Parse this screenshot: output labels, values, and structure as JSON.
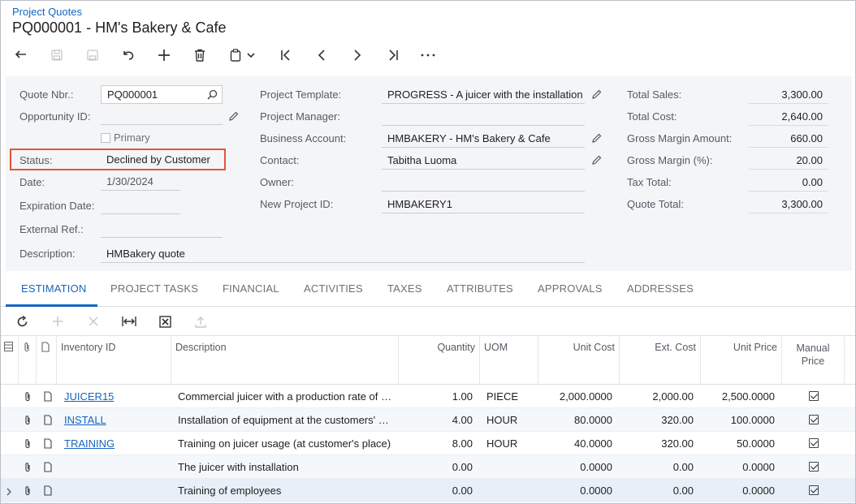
{
  "breadcrumb": "Project Quotes",
  "title": "PQ000001 - HM's Bakery & Cafe",
  "toolbar": {
    "icons": [
      "back-icon",
      "save-close-icon",
      "save-icon",
      "undo-icon",
      "add-icon",
      "delete-icon",
      "copy-paste-icon",
      "chevron-down-icon",
      "first-record-icon",
      "previous-record-icon",
      "next-record-icon",
      "last-record-icon",
      "more-icon"
    ]
  },
  "form": {
    "quote_nbr_label": "Quote Nbr.:",
    "quote_nbr": "PQ000001",
    "opportunity_label": "Opportunity ID:",
    "opportunity": "",
    "primary_label": "Primary",
    "status_label": "Status:",
    "status": "Declined by Customer",
    "date_label": "Date:",
    "date": "1/30/2024",
    "expiration_label": "Expiration Date:",
    "expiration": "",
    "external_ref_label": "External Ref.:",
    "external_ref": "",
    "description_label": "Description:",
    "description": "HMBakery quote",
    "project_template_label": "Project Template:",
    "project_template": "PROGRESS - A juicer with the installation",
    "project_manager_label": "Project Manager:",
    "project_manager": "",
    "business_account_label": "Business Account:",
    "business_account": "HMBAKERY - HM's Bakery & Cafe",
    "contact_label": "Contact:",
    "contact": "Tabitha Luoma",
    "owner_label": "Owner:",
    "owner": "",
    "new_project_label": "New Project ID:",
    "new_project": "HMBAKERY1",
    "total_sales_label": "Total Sales:",
    "total_sales": "3,300.00",
    "total_cost_label": "Total Cost:",
    "total_cost": "2,640.00",
    "gross_margin_amount_label": "Gross Margin Amount:",
    "gross_margin_amount": "660.00",
    "gross_margin_pct_label": "Gross Margin (%):",
    "gross_margin_pct": "20.00",
    "tax_total_label": "Tax Total:",
    "tax_total": "0.00",
    "quote_total_label": "Quote Total:",
    "quote_total": "3,300.00"
  },
  "tabs": [
    "ESTIMATION",
    "PROJECT TASKS",
    "FINANCIAL",
    "ACTIVITIES",
    "TAXES",
    "ATTRIBUTES",
    "APPROVALS",
    "ADDRESSES"
  ],
  "active_tab": "ESTIMATION",
  "grid_toolbar": [
    "refresh-icon",
    "add-row-icon",
    "delete-row-icon",
    "fit-columns-icon",
    "export-excel-icon",
    "upload-icon"
  ],
  "grid": {
    "columns": {
      "inventory_id": "Inventory ID",
      "description": "Description",
      "quantity": "Quantity",
      "uom": "UOM",
      "unit_cost": "Unit Cost",
      "ext_cost": "Ext. Cost",
      "unit_price": "Unit Price",
      "manual_price": "Manual Price"
    },
    "rows": [
      {
        "inventory_id": "JUICER15",
        "description": "Commercial juicer with a production rate of …",
        "quantity": "1.00",
        "uom": "PIECE",
        "unit_cost": "2,000.0000",
        "ext_cost": "2,000.00",
        "unit_price": "2,500.0000",
        "manual_price": true
      },
      {
        "inventory_id": "INSTALL",
        "description": "Installation of equipment at the customers' …",
        "quantity": "4.00",
        "uom": "HOUR",
        "unit_cost": "80.0000",
        "ext_cost": "320.00",
        "unit_price": "100.0000",
        "manual_price": true
      },
      {
        "inventory_id": "TRAINING",
        "description": "Training on juicer usage (at customer's place)",
        "quantity": "8.00",
        "uom": "HOUR",
        "unit_cost": "40.0000",
        "ext_cost": "320.00",
        "unit_price": "50.0000",
        "manual_price": true
      },
      {
        "inventory_id": "",
        "description": "The juicer with installation",
        "quantity": "0.00",
        "uom": "",
        "unit_cost": "0.0000",
        "ext_cost": "0.00",
        "unit_price": "0.0000",
        "manual_price": true
      },
      {
        "inventory_id": "",
        "description": "Training of employees",
        "quantity": "0.00",
        "uom": "",
        "unit_cost": "0.0000",
        "ext_cost": "0.00",
        "unit_price": "0.0000",
        "manual_price": true
      }
    ]
  },
  "colors": {
    "link": "#1565c0",
    "highlight": "#e2553a",
    "form_bg": "#f4f5f7"
  }
}
